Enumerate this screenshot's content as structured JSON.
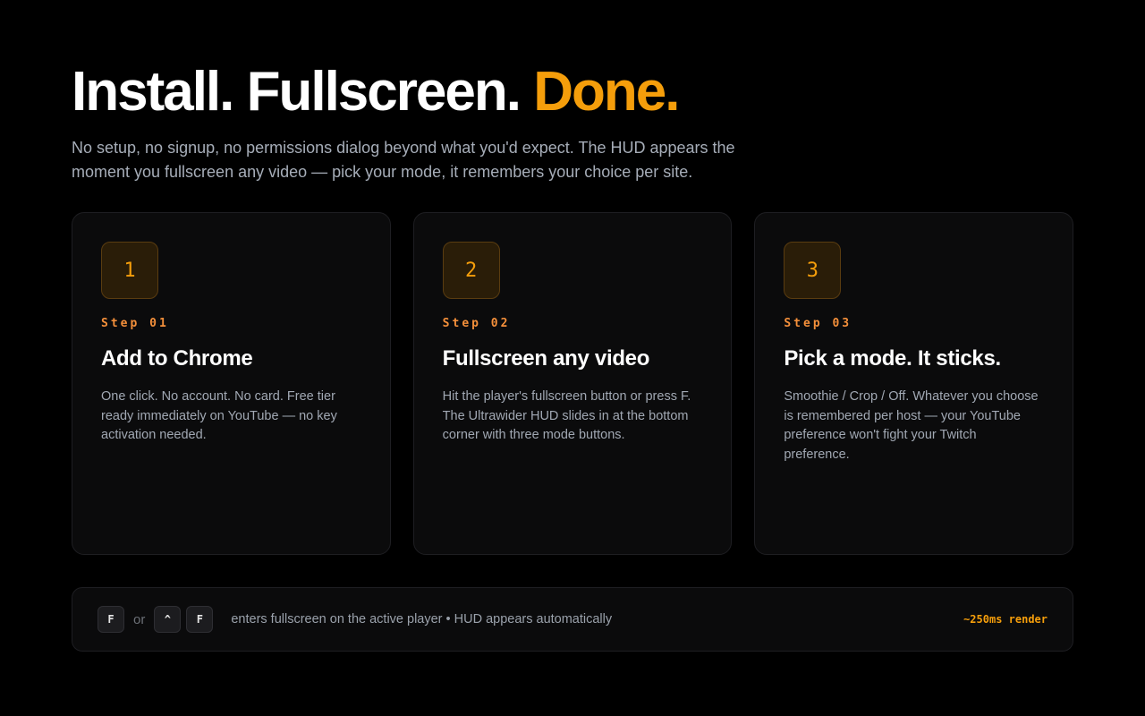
{
  "hero": {
    "headline_main": "Install. Fullscreen.",
    "headline_accent": "Done.",
    "subtitle": "No setup, no signup, no permissions dialog beyond what you'd expect. The HUD appears the moment you fullscreen any video — pick your mode, it remembers your choice per site."
  },
  "steps": [
    {
      "number": "1",
      "label": "Step 01",
      "title": "Add to Chrome",
      "description": "One click. No account. No card. Free tier ready immediately on YouTube — no key activation needed."
    },
    {
      "number": "2",
      "label": "Step 02",
      "title": "Fullscreen any video",
      "description": "Hit the player's fullscreen button or press F. The Ultrawider HUD slides in at the bottom corner with three mode buttons."
    },
    {
      "number": "3",
      "label": "Step 03",
      "title": "Pick a mode. It sticks.",
      "description": "Smoothie / Crop / Off. Whatever you choose is remembered per host — your YouTube preference won't fight your Twitch preference."
    }
  ],
  "shortcut_bar": {
    "key1": "F",
    "or_label": "or",
    "key2": "^",
    "key3": "F",
    "text": "enters fullscreen on the active player • HUD appears automatically",
    "render_badge": "~250ms render"
  },
  "colors": {
    "accent": "#f59e0b",
    "background": "#000000",
    "card": "#0b0b0c"
  }
}
